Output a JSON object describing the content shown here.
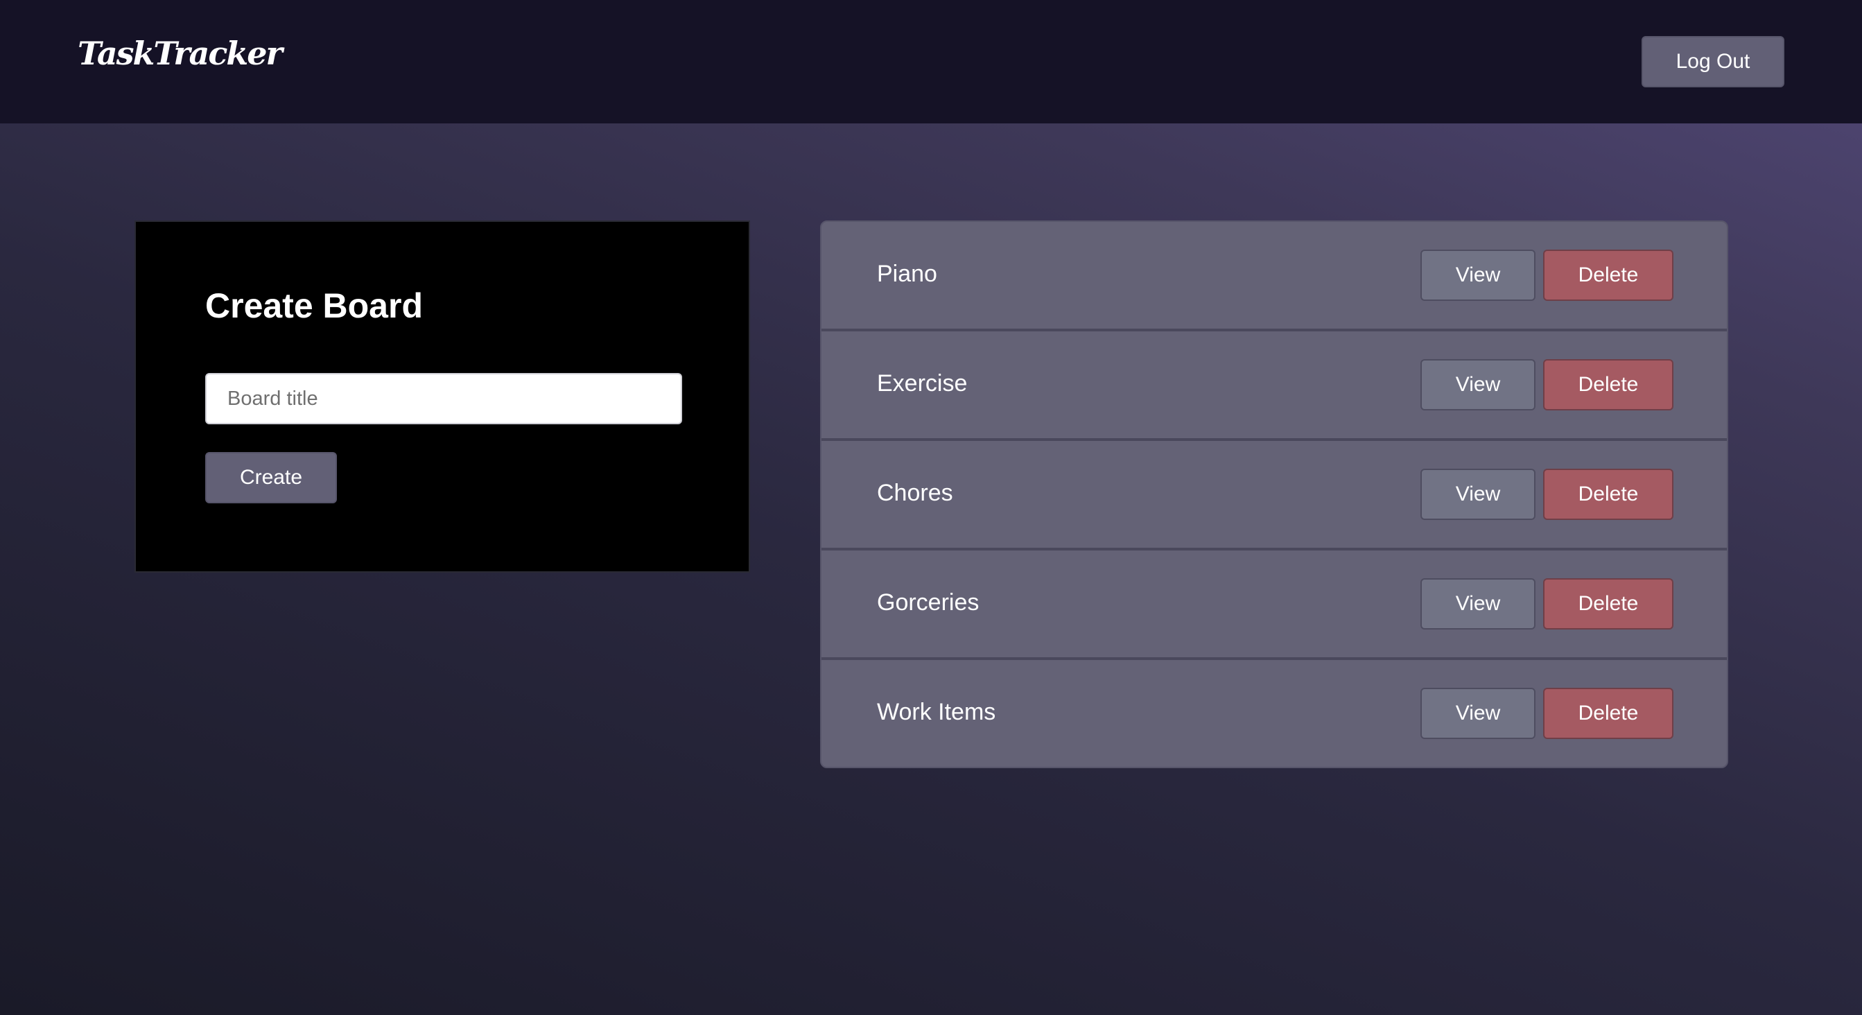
{
  "header": {
    "logo_text": "TaskTracker",
    "logout_label": "Log Out"
  },
  "create_board": {
    "title": "Create Board",
    "input_placeholder": "Board title",
    "input_value": "",
    "create_label": "Create"
  },
  "boards": [
    {
      "name": "Piano",
      "view_label": "View",
      "delete_label": "Delete"
    },
    {
      "name": "Exercise",
      "view_label": "View",
      "delete_label": "Delete"
    },
    {
      "name": "Chores",
      "view_label": "View",
      "delete_label": "Delete"
    },
    {
      "name": "Gorceries",
      "view_label": "View",
      "delete_label": "Delete"
    },
    {
      "name": "Work Items",
      "view_label": "View",
      "delete_label": "Delete"
    }
  ],
  "colors": {
    "header_bg": "#151226",
    "button_bg": "#626076",
    "delete_bg": "#a55a62",
    "card_bg": "#000000",
    "list_bg": "#646276"
  }
}
